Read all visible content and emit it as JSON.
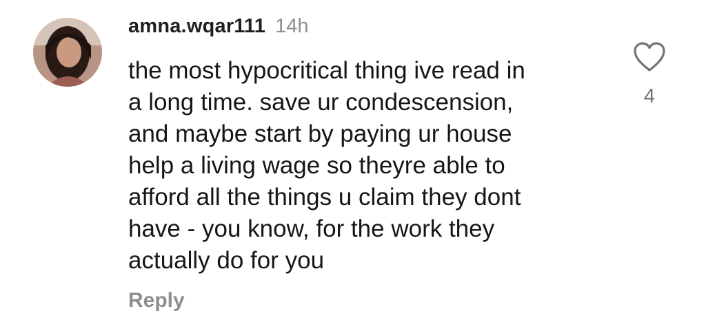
{
  "comment": {
    "username": "amna.wqar111",
    "timestamp": "14h",
    "lines": [
      "the most hypocritical thing ive read in",
      "a long time. save ur condescension,",
      "and maybe start by paying ur house",
      "help a living wage so theyre able to",
      "afford all the things u claim they dont",
      "have - you know, for the work they",
      "actually do for you"
    ],
    "like_count": "4",
    "reply_label": "Reply",
    "like_icon": "heart-outline-icon"
  }
}
